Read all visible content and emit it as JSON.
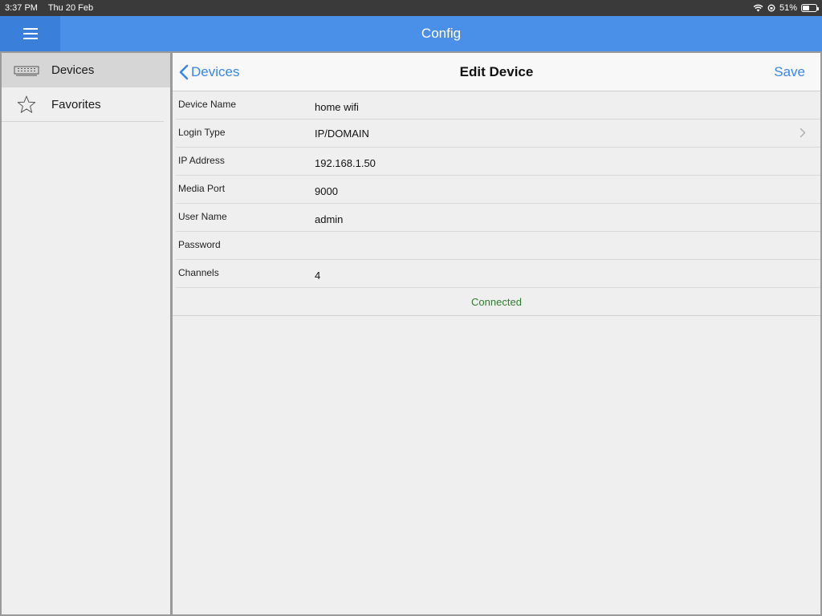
{
  "status_bar": {
    "time": "3:37 PM",
    "date": "Thu 20 Feb",
    "battery": "51%",
    "battery_level": 0.51
  },
  "nav_bar": {
    "title": "Config",
    "menu_icon": "hamburger-icon"
  },
  "sidebar": {
    "items": [
      {
        "label": "Devices",
        "icon": "dvr-device-icon",
        "active": true
      },
      {
        "label": "Favorites",
        "icon": "star-icon",
        "active": false
      }
    ]
  },
  "header": {
    "back_label": "Devices",
    "title": "Edit Device",
    "save_label": "Save"
  },
  "form": {
    "rows": [
      {
        "label": "Device Name",
        "value": "home wifi"
      },
      {
        "label": "Login Type",
        "value": "IP/DOMAIN",
        "has_chevron": true
      },
      {
        "label": "IP Address",
        "value": "192.168.1.50"
      },
      {
        "label": "Media Port",
        "value": "9000"
      },
      {
        "label": "User Name",
        "value": "admin"
      },
      {
        "label": "Password",
        "value": ""
      },
      {
        "label": "Channels",
        "value": "4"
      }
    ],
    "connection_status": "Connected"
  },
  "colors": {
    "accent": "#4a90e8",
    "link": "#3a86e8",
    "connected": "#2e7d2e"
  }
}
